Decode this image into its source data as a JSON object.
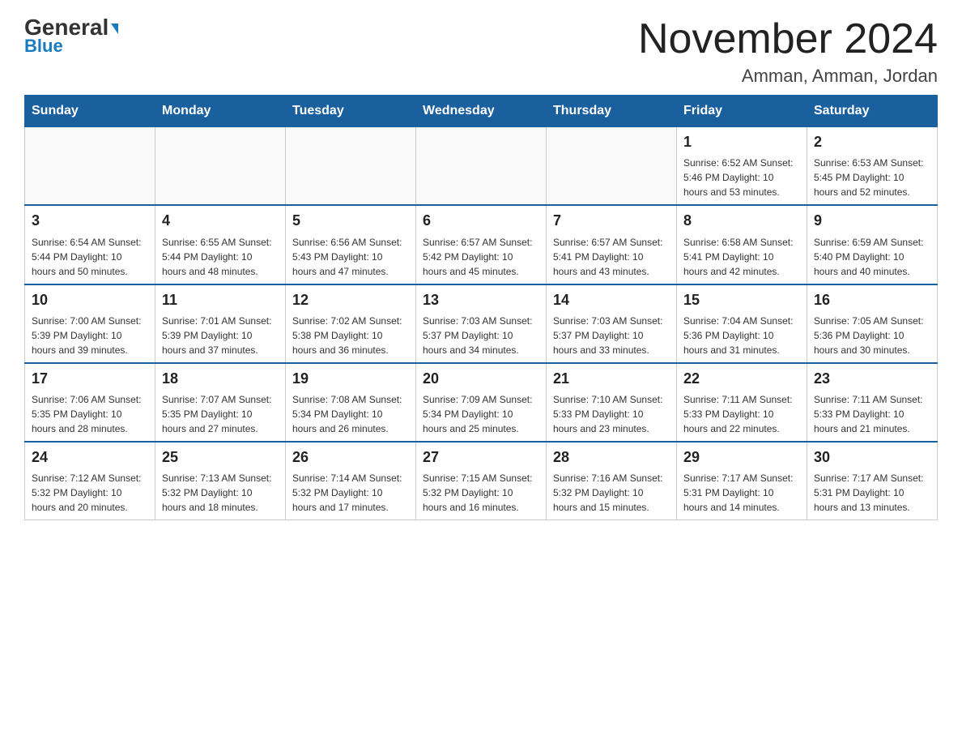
{
  "header": {
    "logo_general": "General",
    "logo_blue": "Blue",
    "month_title": "November 2024",
    "location": "Amman, Amman, Jordan"
  },
  "weekdays": [
    "Sunday",
    "Monday",
    "Tuesday",
    "Wednesday",
    "Thursday",
    "Friday",
    "Saturday"
  ],
  "weeks": [
    [
      {
        "day": "",
        "info": ""
      },
      {
        "day": "",
        "info": ""
      },
      {
        "day": "",
        "info": ""
      },
      {
        "day": "",
        "info": ""
      },
      {
        "day": "",
        "info": ""
      },
      {
        "day": "1",
        "info": "Sunrise: 6:52 AM\nSunset: 5:46 PM\nDaylight: 10 hours and 53 minutes."
      },
      {
        "day": "2",
        "info": "Sunrise: 6:53 AM\nSunset: 5:45 PM\nDaylight: 10 hours and 52 minutes."
      }
    ],
    [
      {
        "day": "3",
        "info": "Sunrise: 6:54 AM\nSunset: 5:44 PM\nDaylight: 10 hours and 50 minutes."
      },
      {
        "day": "4",
        "info": "Sunrise: 6:55 AM\nSunset: 5:44 PM\nDaylight: 10 hours and 48 minutes."
      },
      {
        "day": "5",
        "info": "Sunrise: 6:56 AM\nSunset: 5:43 PM\nDaylight: 10 hours and 47 minutes."
      },
      {
        "day": "6",
        "info": "Sunrise: 6:57 AM\nSunset: 5:42 PM\nDaylight: 10 hours and 45 minutes."
      },
      {
        "day": "7",
        "info": "Sunrise: 6:57 AM\nSunset: 5:41 PM\nDaylight: 10 hours and 43 minutes."
      },
      {
        "day": "8",
        "info": "Sunrise: 6:58 AM\nSunset: 5:41 PM\nDaylight: 10 hours and 42 minutes."
      },
      {
        "day": "9",
        "info": "Sunrise: 6:59 AM\nSunset: 5:40 PM\nDaylight: 10 hours and 40 minutes."
      }
    ],
    [
      {
        "day": "10",
        "info": "Sunrise: 7:00 AM\nSunset: 5:39 PM\nDaylight: 10 hours and 39 minutes."
      },
      {
        "day": "11",
        "info": "Sunrise: 7:01 AM\nSunset: 5:39 PM\nDaylight: 10 hours and 37 minutes."
      },
      {
        "day": "12",
        "info": "Sunrise: 7:02 AM\nSunset: 5:38 PM\nDaylight: 10 hours and 36 minutes."
      },
      {
        "day": "13",
        "info": "Sunrise: 7:03 AM\nSunset: 5:37 PM\nDaylight: 10 hours and 34 minutes."
      },
      {
        "day": "14",
        "info": "Sunrise: 7:03 AM\nSunset: 5:37 PM\nDaylight: 10 hours and 33 minutes."
      },
      {
        "day": "15",
        "info": "Sunrise: 7:04 AM\nSunset: 5:36 PM\nDaylight: 10 hours and 31 minutes."
      },
      {
        "day": "16",
        "info": "Sunrise: 7:05 AM\nSunset: 5:36 PM\nDaylight: 10 hours and 30 minutes."
      }
    ],
    [
      {
        "day": "17",
        "info": "Sunrise: 7:06 AM\nSunset: 5:35 PM\nDaylight: 10 hours and 28 minutes."
      },
      {
        "day": "18",
        "info": "Sunrise: 7:07 AM\nSunset: 5:35 PM\nDaylight: 10 hours and 27 minutes."
      },
      {
        "day": "19",
        "info": "Sunrise: 7:08 AM\nSunset: 5:34 PM\nDaylight: 10 hours and 26 minutes."
      },
      {
        "day": "20",
        "info": "Sunrise: 7:09 AM\nSunset: 5:34 PM\nDaylight: 10 hours and 25 minutes."
      },
      {
        "day": "21",
        "info": "Sunrise: 7:10 AM\nSunset: 5:33 PM\nDaylight: 10 hours and 23 minutes."
      },
      {
        "day": "22",
        "info": "Sunrise: 7:11 AM\nSunset: 5:33 PM\nDaylight: 10 hours and 22 minutes."
      },
      {
        "day": "23",
        "info": "Sunrise: 7:11 AM\nSunset: 5:33 PM\nDaylight: 10 hours and 21 minutes."
      }
    ],
    [
      {
        "day": "24",
        "info": "Sunrise: 7:12 AM\nSunset: 5:32 PM\nDaylight: 10 hours and 20 minutes."
      },
      {
        "day": "25",
        "info": "Sunrise: 7:13 AM\nSunset: 5:32 PM\nDaylight: 10 hours and 18 minutes."
      },
      {
        "day": "26",
        "info": "Sunrise: 7:14 AM\nSunset: 5:32 PM\nDaylight: 10 hours and 17 minutes."
      },
      {
        "day": "27",
        "info": "Sunrise: 7:15 AM\nSunset: 5:32 PM\nDaylight: 10 hours and 16 minutes."
      },
      {
        "day": "28",
        "info": "Sunrise: 7:16 AM\nSunset: 5:32 PM\nDaylight: 10 hours and 15 minutes."
      },
      {
        "day": "29",
        "info": "Sunrise: 7:17 AM\nSunset: 5:31 PM\nDaylight: 10 hours and 14 minutes."
      },
      {
        "day": "30",
        "info": "Sunrise: 7:17 AM\nSunset: 5:31 PM\nDaylight: 10 hours and 13 minutes."
      }
    ]
  ]
}
